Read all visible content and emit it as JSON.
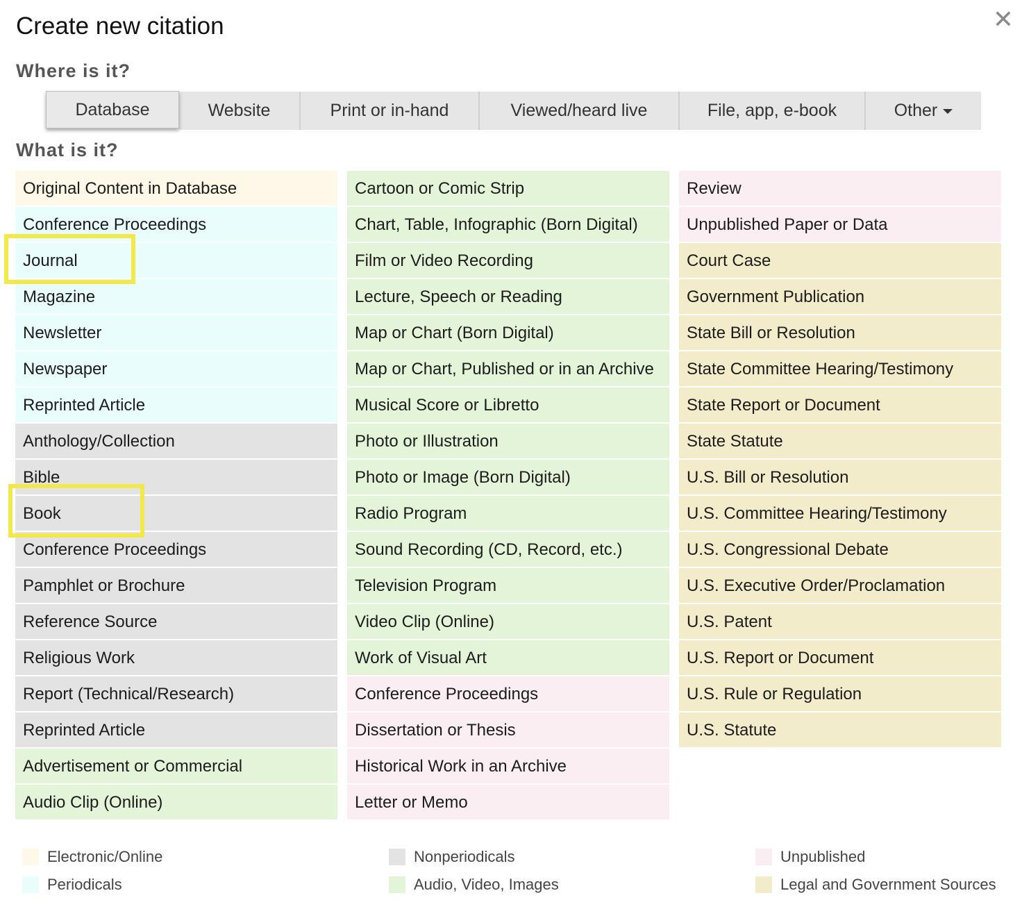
{
  "dialog": {
    "title": "Create new citation",
    "close_symbol": "✕"
  },
  "where": {
    "heading": "Where is it?",
    "tabs": [
      {
        "label": "Database",
        "active": true
      },
      {
        "label": "Website",
        "active": false
      },
      {
        "label": "Print or in-hand",
        "active": false
      },
      {
        "label": "Viewed/heard live",
        "active": false
      },
      {
        "label": "File, app, e-book",
        "active": false
      },
      {
        "label": "Other",
        "active": false,
        "dropdown": true
      }
    ]
  },
  "what": {
    "heading": "What is it?",
    "columns": [
      [
        {
          "label": "Original Content in Database",
          "category": "electronic"
        },
        {
          "label": "Conference Proceedings",
          "category": "periodicals"
        },
        {
          "label": "Journal",
          "category": "periodicals",
          "highlighted": true
        },
        {
          "label": "Magazine",
          "category": "periodicals"
        },
        {
          "label": "Newsletter",
          "category": "periodicals"
        },
        {
          "label": "Newspaper",
          "category": "periodicals"
        },
        {
          "label": "Reprinted Article",
          "category": "periodicals"
        },
        {
          "label": "Anthology/Collection",
          "category": "nonperiodicals"
        },
        {
          "label": "Bible",
          "category": "nonperiodicals"
        },
        {
          "label": "Book",
          "category": "nonperiodicals",
          "highlighted": true
        },
        {
          "label": "Conference Proceedings",
          "category": "nonperiodicals"
        },
        {
          "label": "Pamphlet or Brochure",
          "category": "nonperiodicals"
        },
        {
          "label": "Reference Source",
          "category": "nonperiodicals"
        },
        {
          "label": "Religious Work",
          "category": "nonperiodicals"
        },
        {
          "label": "Report (Technical/Research)",
          "category": "nonperiodicals"
        },
        {
          "label": "Reprinted Article",
          "category": "nonperiodicals"
        },
        {
          "label": "Advertisement or Commercial",
          "category": "audiovisual"
        },
        {
          "label": "Audio Clip (Online)",
          "category": "audiovisual"
        }
      ],
      [
        {
          "label": "Cartoon or Comic Strip",
          "category": "audiovisual"
        },
        {
          "label": "Chart, Table, Infographic (Born Digital)",
          "category": "audiovisual"
        },
        {
          "label": "Film or Video Recording",
          "category": "audiovisual"
        },
        {
          "label": "Lecture, Speech or Reading",
          "category": "audiovisual"
        },
        {
          "label": "Map or Chart (Born Digital)",
          "category": "audiovisual"
        },
        {
          "label": "Map or Chart, Published or in an Archive",
          "category": "audiovisual"
        },
        {
          "label": "Musical Score or Libretto",
          "category": "audiovisual"
        },
        {
          "label": "Photo or Illustration",
          "category": "audiovisual"
        },
        {
          "label": "Photo or Image (Born Digital)",
          "category": "audiovisual"
        },
        {
          "label": "Radio Program",
          "category": "audiovisual"
        },
        {
          "label": "Sound Recording (CD, Record, etc.)",
          "category": "audiovisual"
        },
        {
          "label": "Television Program",
          "category": "audiovisual"
        },
        {
          "label": "Video Clip (Online)",
          "category": "audiovisual"
        },
        {
          "label": "Work of Visual Art",
          "category": "audiovisual"
        },
        {
          "label": "Conference Proceedings",
          "category": "unpublished"
        },
        {
          "label": "Dissertation or Thesis",
          "category": "unpublished"
        },
        {
          "label": "Historical Work in an Archive",
          "category": "unpublished"
        },
        {
          "label": "Letter or Memo",
          "category": "unpublished"
        }
      ],
      [
        {
          "label": "Review",
          "category": "unpublished"
        },
        {
          "label": "Unpublished Paper or Data",
          "category": "unpublished"
        },
        {
          "label": "Court Case",
          "category": "legal"
        },
        {
          "label": "Government Publication",
          "category": "legal"
        },
        {
          "label": "State Bill or Resolution",
          "category": "legal"
        },
        {
          "label": "State Committee Hearing/Testimony",
          "category": "legal"
        },
        {
          "label": "State Report or Document",
          "category": "legal"
        },
        {
          "label": "State Statute",
          "category": "legal"
        },
        {
          "label": "U.S. Bill or Resolution",
          "category": "legal"
        },
        {
          "label": "U.S. Committee Hearing/Testimony",
          "category": "legal"
        },
        {
          "label": "U.S. Congressional Debate",
          "category": "legal"
        },
        {
          "label": "U.S. Executive Order/Proclamation",
          "category": "legal"
        },
        {
          "label": "U.S. Patent",
          "category": "legal"
        },
        {
          "label": "U.S. Report or Document",
          "category": "legal"
        },
        {
          "label": "U.S. Rule or Regulation",
          "category": "legal"
        },
        {
          "label": "U.S. Statute",
          "category": "legal"
        }
      ]
    ]
  },
  "legend": [
    {
      "label": "Electronic/Online",
      "category": "electronic",
      "color": "#fdf8e8"
    },
    {
      "label": "Periodicals",
      "category": "periodicals",
      "color": "#eafdfd"
    },
    {
      "label": "Nonperiodicals",
      "category": "nonperiodicals",
      "color": "#e3e3e3"
    },
    {
      "label": "Audio, Video, Images",
      "category": "audiovisual",
      "color": "#e4f4d9"
    },
    {
      "label": "Unpublished",
      "category": "unpublished",
      "color": "#fbeef2"
    },
    {
      "label": "Legal and Government Sources",
      "category": "legal",
      "color": "#f2eccb"
    }
  ],
  "colors": {
    "highlight": "#f2e84a",
    "tab_background": "#e6e6e6"
  }
}
